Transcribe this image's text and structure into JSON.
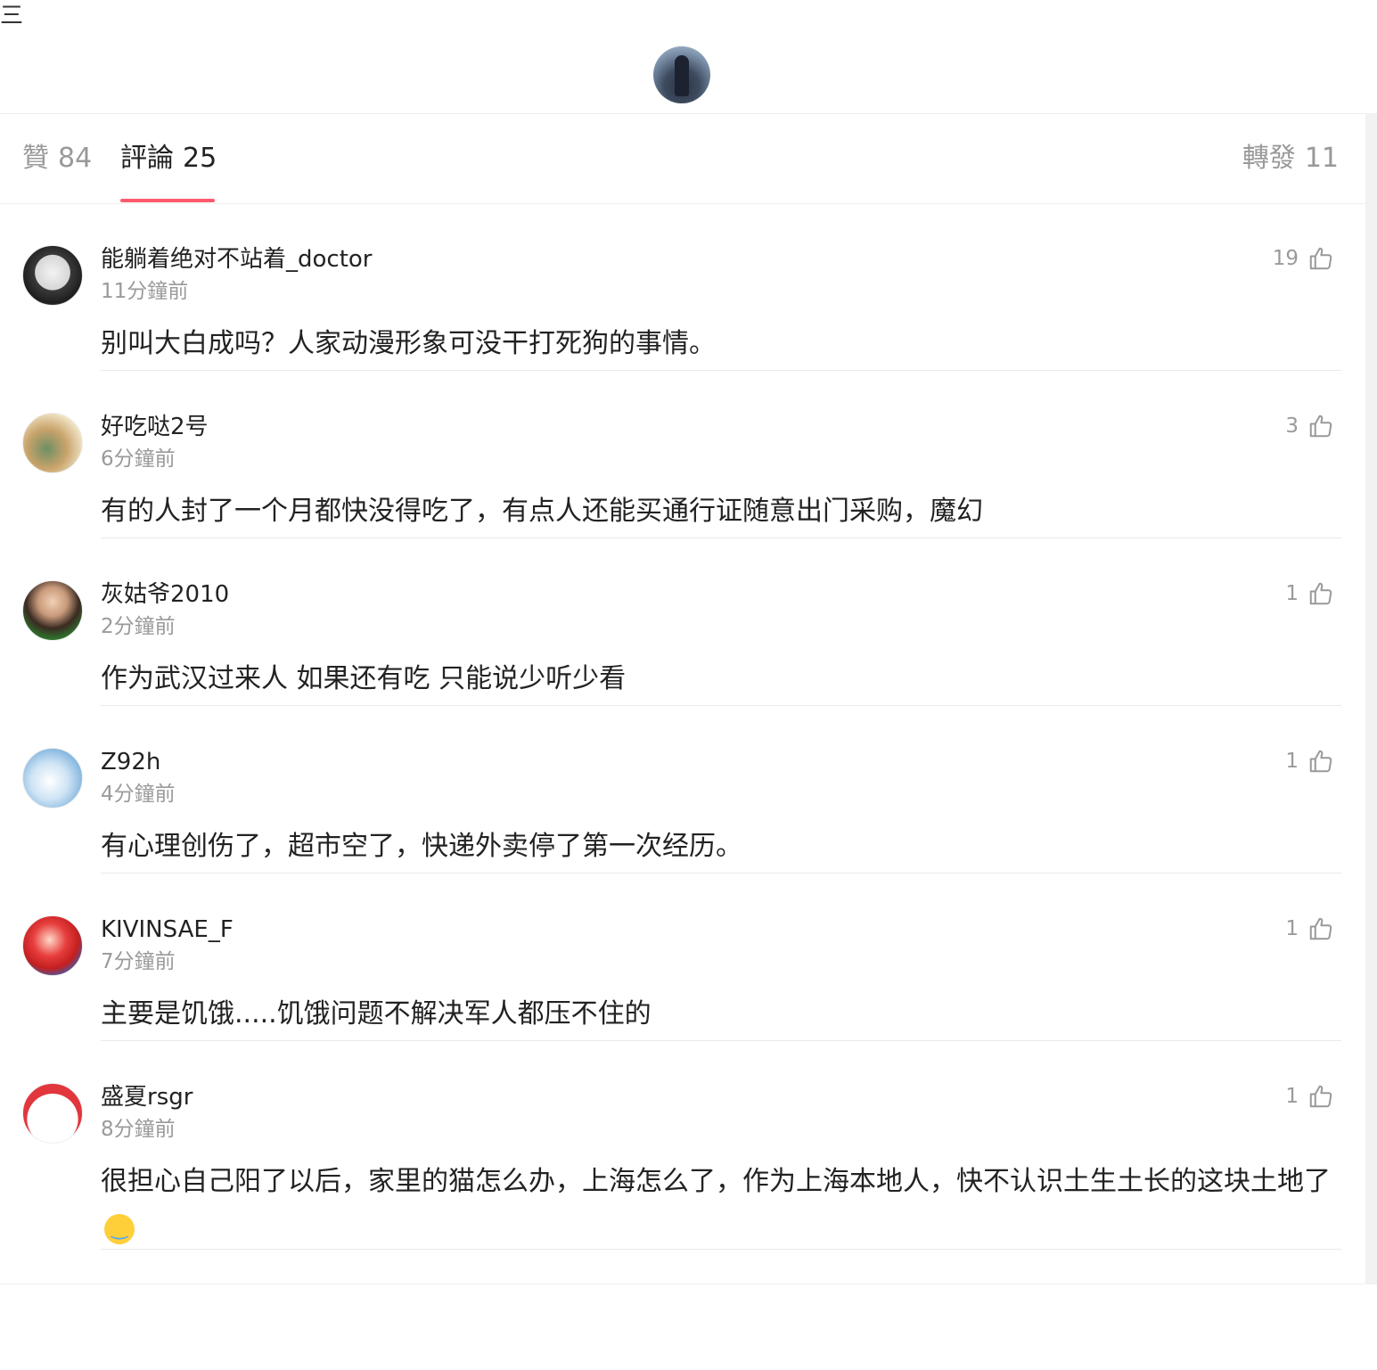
{
  "header": {
    "menu_icon": "三",
    "avatar": "profile-avatar-image"
  },
  "tabs": {
    "likes": {
      "label": "贊",
      "count": "84"
    },
    "comments": {
      "label": "評論",
      "count": "25"
    },
    "reposts": {
      "label": "轉發",
      "count": "11"
    },
    "active": "comments",
    "accent_color": "#ff5a6e"
  },
  "comments": [
    {
      "username": "能躺着绝对不站着_doctor",
      "time": "11分鐘前",
      "likes": "19",
      "text": "别叫大白成吗？人家动漫形象可没干打死狗的事情。"
    },
    {
      "username": "好吃哒2号",
      "time": "6分鐘前",
      "likes": "3",
      "text": "有的人封了一个月都快没得吃了，有点人还能买通行证随意出门采购，魔幻"
    },
    {
      "username": "灰姑爷2010",
      "time": "2分鐘前",
      "likes": "1",
      "text": "作为武汉过来人 如果还有吃 只能说少听少看"
    },
    {
      "username": "Z92h",
      "time": "4分鐘前",
      "likes": "1",
      "text": "有心理创伤了，超市空了，快递外卖停了第一次经历。"
    },
    {
      "username": "KIVINSAE_F",
      "time": "7分鐘前",
      "likes": "1",
      "text": "主要是饥饿.....饥饿问题不解决军人都压不住的"
    },
    {
      "username": "盛夏rsgr",
      "time": "8分鐘前",
      "likes": "1",
      "text": "很担心自己阳了以后，家里的猫怎么办，上海怎么了，作为上海本地人，快不认识土生土长的这块土地了",
      "emoji": "crying-face-emoji"
    }
  ]
}
